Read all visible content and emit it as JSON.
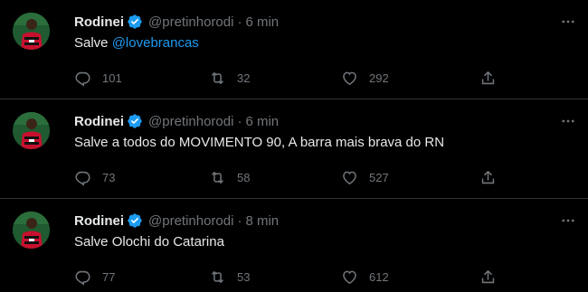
{
  "colors": {
    "background": "#000000",
    "text": "#e7e9ea",
    "muted": "#71767b",
    "accent": "#1d9bf0",
    "divider": "#2f3336"
  },
  "tweets": [
    {
      "name": "Rodinei",
      "handle": "@pretinhorodi",
      "separator": "·",
      "time": "6 min",
      "text": "Salve ",
      "mention": "@lovebrancas",
      "replies": "101",
      "retweets": "32",
      "likes": "292"
    },
    {
      "name": "Rodinei",
      "handle": "@pretinhorodi",
      "separator": "·",
      "time": "6 min",
      "text": "Salve a todos do MOVIMENTO 90, A barra mais brava do RN",
      "mention": "",
      "replies": "73",
      "retweets": "58",
      "likes": "527"
    },
    {
      "name": "Rodinei",
      "handle": "@pretinhorodi",
      "separator": "·",
      "time": "8 min",
      "text": "Salve Olochi do Catarina",
      "mention": "",
      "replies": "77",
      "retweets": "53",
      "likes": "612"
    }
  ],
  "icons": {
    "verified": "verified-badge-icon",
    "more": "more-horizontal-icon",
    "reply": "reply-icon",
    "retweet": "retweet-icon",
    "like": "heart-icon",
    "share": "share-icon"
  }
}
